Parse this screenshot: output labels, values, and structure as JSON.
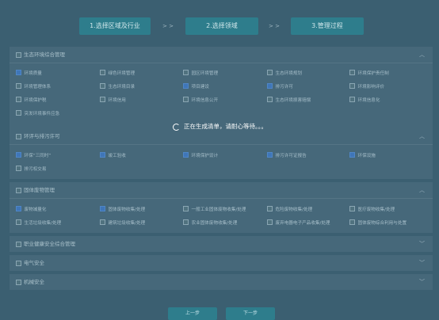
{
  "steps": {
    "step1": "1.选择区域及行业",
    "arrow1": "> >",
    "step2": "2.选择领域",
    "arrow2": "> >",
    "step3": "3.管理过程"
  },
  "sections": {
    "eco": {
      "title": "生态环境综合管理",
      "items": [
        {
          "label": "环境质量",
          "checked": true
        },
        {
          "label": "绿色环境管理",
          "checked": false
        },
        {
          "label": "园区环境管理",
          "checked": false
        },
        {
          "label": "生态环境规划",
          "checked": false
        },
        {
          "label": "环境保护责任制",
          "checked": false
        },
        {
          "label": "环境管理体系",
          "checked": false
        },
        {
          "label": "生态环境目录",
          "checked": false
        },
        {
          "label": "项目建设",
          "checked": true
        },
        {
          "label": "排污许可",
          "checked": true
        },
        {
          "label": "环境影响评价",
          "checked": false
        },
        {
          "label": "环境保护税",
          "checked": false
        },
        {
          "label": "环境信用",
          "checked": false
        },
        {
          "label": "环境信息公开",
          "checked": false
        },
        {
          "label": "生态环境损害赔偿",
          "checked": false
        },
        {
          "label": "环境信息化",
          "checked": false
        },
        {
          "label": "突发环境事件应急",
          "checked": false
        }
      ]
    },
    "eia": {
      "title": "环评与排污许可",
      "items": [
        {
          "label": "环保“三同时”",
          "checked": true
        },
        {
          "label": "竣工验收",
          "checked": true
        },
        {
          "label": "环境保护设计",
          "checked": true
        },
        {
          "label": "排污许可证报告",
          "checked": true
        },
        {
          "label": "环保设施",
          "checked": true
        },
        {
          "label": "排污权交易",
          "checked": false
        }
      ]
    },
    "waste": {
      "title": "固体废物管理",
      "items": [
        {
          "label": "废物减量化",
          "checked": true
        },
        {
          "label": "固体废物收集/处理",
          "checked": true
        },
        {
          "label": "一般工业固体废物收集/处理",
          "checked": false
        },
        {
          "label": "危险废物收集/处理",
          "checked": false
        },
        {
          "label": "医疗废物收集/处理",
          "checked": false
        },
        {
          "label": "生活垃圾收集/处理",
          "checked": false
        },
        {
          "label": "建筑垃圾收集/处理",
          "checked": false
        },
        {
          "label": "农业固体废物收集/处理",
          "checked": false
        },
        {
          "label": "废弃电器电子产品收集/处理",
          "checked": false
        },
        {
          "label": "固体废物综合利用与处置",
          "checked": false
        }
      ]
    },
    "ohs": {
      "title": "职业健康安全综合管理"
    },
    "elec": {
      "title": "电气安全"
    },
    "mech": {
      "title": "机械安全"
    }
  },
  "loading_text": "正在生成清单，请耐心等待。。。",
  "buttons": {
    "prev": "上一步",
    "next": "下一步"
  },
  "colors": {
    "step_bg": "#2e7d8c",
    "checkbox_checked": "#3f76b8",
    "backdrop": "#3b5f71"
  }
}
